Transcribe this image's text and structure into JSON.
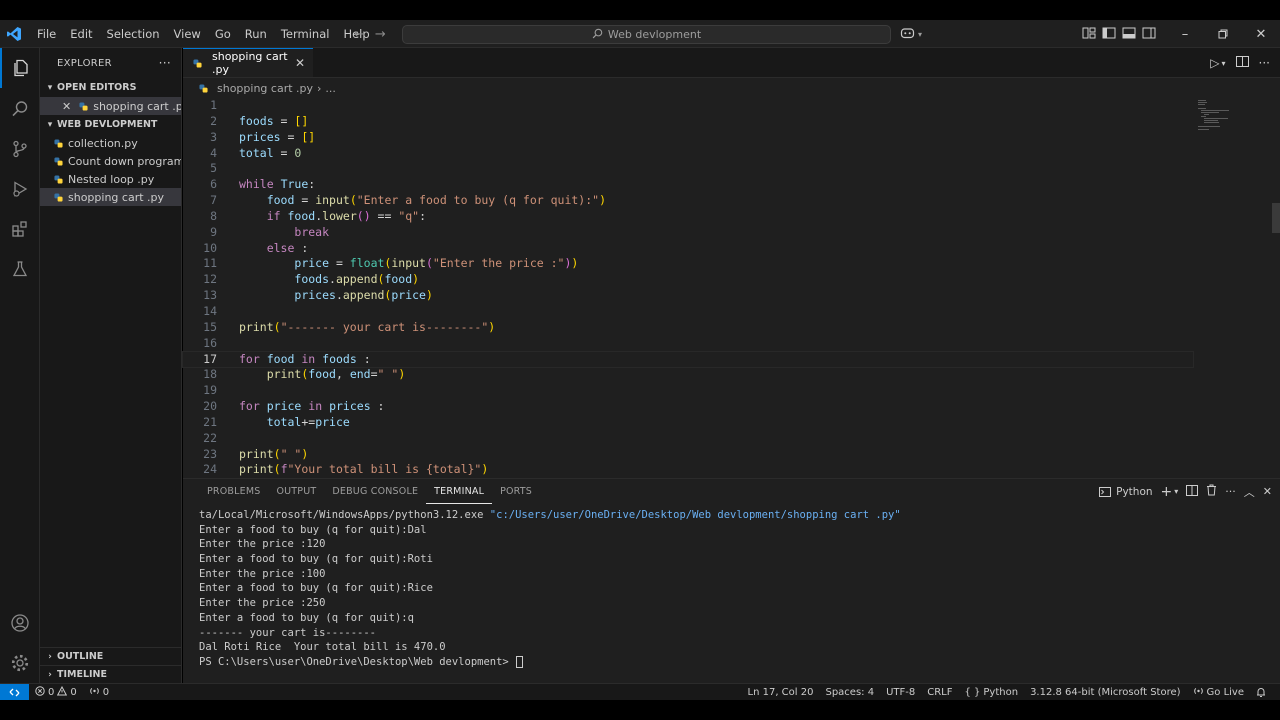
{
  "colors": {
    "accent": "#0078d4",
    "python_blue": "#3572A5",
    "python_yellow": "#FFD43B",
    "editor_bg": "#1f1f1f",
    "sidebar_bg": "#181818"
  },
  "menu": [
    "File",
    "Edit",
    "Selection",
    "View",
    "Go",
    "Run",
    "Terminal",
    "Help"
  ],
  "command_center": {
    "text": "Web devlopment"
  },
  "activity_icons": [
    "files-icon",
    "search-icon",
    "source-control-icon",
    "run-debug-icon",
    "extensions-icon",
    "testing-icon",
    "account-icon",
    "manage-gear-icon"
  ],
  "sidebar": {
    "header": "EXPLORER",
    "open_editors": {
      "label": "OPEN EDITORS",
      "items": [
        {
          "name": "shopping cart .py"
        }
      ]
    },
    "folder": {
      "label": "WEB DEVLOPMENT",
      "items": [
        {
          "name": "collection.py"
        },
        {
          "name": "Count down program..."
        },
        {
          "name": "Nested loop .py"
        },
        {
          "name": "shopping cart .py"
        }
      ]
    },
    "outline": "OUTLINE",
    "timeline": "TIMELINE"
  },
  "tab": {
    "name": "shopping cart .py"
  },
  "breadcrumb": {
    "file": "shopping cart .py",
    "more": "..."
  },
  "editor": {
    "current_line": 17,
    "lines": [
      {
        "n": "1",
        "tokens": []
      },
      {
        "n": "2",
        "tokens": [
          {
            "t": "foods",
            "c": "vr"
          },
          {
            "t": " = ",
            "c": "op"
          },
          {
            "t": "[]",
            "c": "br"
          }
        ]
      },
      {
        "n": "3",
        "tokens": [
          {
            "t": "prices",
            "c": "vr"
          },
          {
            "t": " = ",
            "c": "op"
          },
          {
            "t": "[]",
            "c": "br"
          }
        ]
      },
      {
        "n": "4",
        "tokens": [
          {
            "t": "total",
            "c": "vr"
          },
          {
            "t": " = ",
            "c": "op"
          },
          {
            "t": "0",
            "c": "nm"
          }
        ]
      },
      {
        "n": "5",
        "tokens": []
      },
      {
        "n": "6",
        "tokens": [
          {
            "t": "while",
            "c": "kw"
          },
          {
            "t": " ",
            "c": "op"
          },
          {
            "t": "True",
            "c": "vr"
          },
          {
            "t": ":",
            "c": "op"
          }
        ]
      },
      {
        "n": "7",
        "tokens": [
          {
            "t": "    ",
            "c": "op"
          },
          {
            "t": "food",
            "c": "vr"
          },
          {
            "t": " = ",
            "c": "op"
          },
          {
            "t": "input",
            "c": "fn"
          },
          {
            "t": "(",
            "c": "br"
          },
          {
            "t": "\"Enter a food to buy (q for quit):\"",
            "c": "st"
          },
          {
            "t": ")",
            "c": "br"
          }
        ]
      },
      {
        "n": "8",
        "tokens": [
          {
            "t": "    ",
            "c": "op"
          },
          {
            "t": "if",
            "c": "kw"
          },
          {
            "t": " ",
            "c": "op"
          },
          {
            "t": "food",
            "c": "vr"
          },
          {
            "t": ".",
            "c": "op"
          },
          {
            "t": "lower",
            "c": "fn"
          },
          {
            "t": "()",
            "c": "pn"
          },
          {
            "t": " == ",
            "c": "op"
          },
          {
            "t": "\"q\"",
            "c": "st"
          },
          {
            "t": ":",
            "c": "op"
          }
        ]
      },
      {
        "n": "9",
        "tokens": [
          {
            "t": "        ",
            "c": "op"
          },
          {
            "t": "break",
            "c": "kw"
          }
        ]
      },
      {
        "n": "10",
        "tokens": [
          {
            "t": "    ",
            "c": "op"
          },
          {
            "t": "else",
            "c": "kw"
          },
          {
            "t": " :",
            "c": "op"
          }
        ]
      },
      {
        "n": "11",
        "tokens": [
          {
            "t": "        ",
            "c": "op"
          },
          {
            "t": "price",
            "c": "vr"
          },
          {
            "t": " = ",
            "c": "op"
          },
          {
            "t": "float",
            "c": "bi"
          },
          {
            "t": "(",
            "c": "br"
          },
          {
            "t": "input",
            "c": "fn"
          },
          {
            "t": "(",
            "c": "pn"
          },
          {
            "t": "\"Enter the price :\"",
            "c": "st"
          },
          {
            "t": ")",
            "c": "pn"
          },
          {
            "t": ")",
            "c": "br"
          }
        ]
      },
      {
        "n": "12",
        "tokens": [
          {
            "t": "        ",
            "c": "op"
          },
          {
            "t": "foods",
            "c": "vr"
          },
          {
            "t": ".",
            "c": "op"
          },
          {
            "t": "append",
            "c": "fn"
          },
          {
            "t": "(",
            "c": "br"
          },
          {
            "t": "food",
            "c": "vr"
          },
          {
            "t": ")",
            "c": "br"
          }
        ]
      },
      {
        "n": "13",
        "tokens": [
          {
            "t": "        ",
            "c": "op"
          },
          {
            "t": "prices",
            "c": "vr"
          },
          {
            "t": ".",
            "c": "op"
          },
          {
            "t": "append",
            "c": "fn"
          },
          {
            "t": "(",
            "c": "br"
          },
          {
            "t": "price",
            "c": "vr"
          },
          {
            "t": ")",
            "c": "br"
          }
        ]
      },
      {
        "n": "14",
        "tokens": []
      },
      {
        "n": "15",
        "tokens": [
          {
            "t": "print",
            "c": "fn"
          },
          {
            "t": "(",
            "c": "br"
          },
          {
            "t": "\"------- your cart is--------\"",
            "c": "st"
          },
          {
            "t": ")",
            "c": "br"
          }
        ]
      },
      {
        "n": "16",
        "tokens": []
      },
      {
        "n": "17",
        "tokens": [
          {
            "t": "for",
            "c": "kw"
          },
          {
            "t": " ",
            "c": "op"
          },
          {
            "t": "food",
            "c": "vr"
          },
          {
            "t": " ",
            "c": "op"
          },
          {
            "t": "in",
            "c": "kw"
          },
          {
            "t": " ",
            "c": "op"
          },
          {
            "t": "foods",
            "c": "vr"
          },
          {
            "t": " :",
            "c": "op"
          }
        ]
      },
      {
        "n": "18",
        "tokens": [
          {
            "t": "    ",
            "c": "op"
          },
          {
            "t": "print",
            "c": "fn"
          },
          {
            "t": "(",
            "c": "br"
          },
          {
            "t": "food",
            "c": "vr"
          },
          {
            "t": ", ",
            "c": "op"
          },
          {
            "t": "end",
            "c": "vr"
          },
          {
            "t": "=",
            "c": "op"
          },
          {
            "t": "\" \"",
            "c": "st"
          },
          {
            "t": ")",
            "c": "br"
          }
        ]
      },
      {
        "n": "19",
        "tokens": []
      },
      {
        "n": "20",
        "tokens": [
          {
            "t": "for",
            "c": "kw"
          },
          {
            "t": " ",
            "c": "op"
          },
          {
            "t": "price",
            "c": "vr"
          },
          {
            "t": " ",
            "c": "op"
          },
          {
            "t": "in",
            "c": "kw"
          },
          {
            "t": " ",
            "c": "op"
          },
          {
            "t": "prices",
            "c": "vr"
          },
          {
            "t": " :",
            "c": "op"
          }
        ]
      },
      {
        "n": "21",
        "tokens": [
          {
            "t": "    ",
            "c": "op"
          },
          {
            "t": "total",
            "c": "vr"
          },
          {
            "t": "+=",
            "c": "op"
          },
          {
            "t": "price",
            "c": "vr"
          }
        ]
      },
      {
        "n": "22",
        "tokens": []
      },
      {
        "n": "23",
        "tokens": [
          {
            "t": "print",
            "c": "fn"
          },
          {
            "t": "(",
            "c": "br"
          },
          {
            "t": "\" \"",
            "c": "st"
          },
          {
            "t": ")",
            "c": "br"
          }
        ]
      },
      {
        "n": "24",
        "tokens": [
          {
            "t": "print",
            "c": "fn"
          },
          {
            "t": "(",
            "c": "br"
          },
          {
            "t": "f",
            "c": "kw"
          },
          {
            "t": "\"Your total bill is {total}\"",
            "c": "st"
          },
          {
            "t": ")",
            "c": "br"
          }
        ]
      }
    ]
  },
  "panel": {
    "tabs": [
      "PROBLEMS",
      "OUTPUT",
      "DEBUG CONSOLE",
      "TERMINAL",
      "PORTS"
    ],
    "active_tab": "TERMINAL",
    "terminal_profile": "Python",
    "terminal_first_plain": "ta/Local/Microsoft/WindowsApps/python3.12.exe ",
    "terminal_first_path": "\"c:/Users/user/OneDrive/Desktop/Web devlopment/shopping cart .py\"",
    "terminal_lines": [
      "Enter a food to buy (q for quit):Dal",
      "Enter the price :120",
      "Enter a food to buy (q for quit):Roti",
      "Enter the price :100",
      "Enter a food to buy (q for quit):Rice",
      "Enter the price :250",
      "Enter a food to buy (q for quit):q",
      "------- your cart is--------",
      "Dal Roti Rice  Your total bill is 470.0"
    ],
    "prompt": "PS C:\\Users\\user\\OneDrive\\Desktop\\Web devlopment> "
  },
  "status": {
    "errors": "0",
    "warnings": "0",
    "ports": "0",
    "position": "Ln 17, Col 20",
    "spaces": "Spaces: 4",
    "encoding": "UTF-8",
    "eol": "CRLF",
    "language": "Python",
    "interpreter": "3.12.8 64-bit (Microsoft Store)",
    "golive": "Go Live"
  }
}
